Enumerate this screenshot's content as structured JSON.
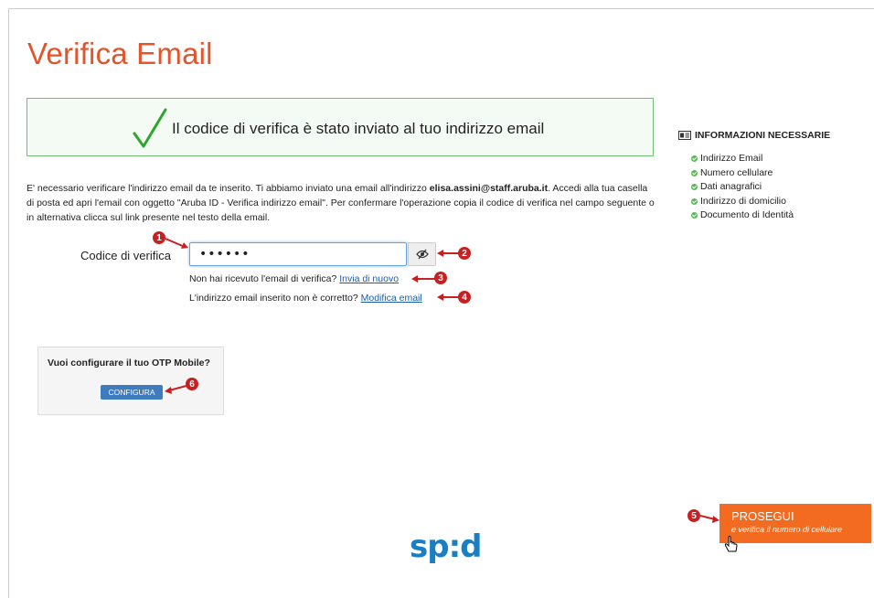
{
  "page": {
    "title": "Verifica Email"
  },
  "success": {
    "message": "Il codice di verifica è stato inviato al tuo indirizzo email"
  },
  "description": {
    "part1": "E' necessario verificare l'indirizzo email da te inserito. Ti abbiamo inviato una email all'indirizzo ",
    "email": "elisa.assini@staff.aruba.it",
    "part2": ". Accedi alla tua casella di posta ed apri l'email con oggetto \"Aruba ID - Verifica indirizzo email\". Per confermare l'operazione copia il codice di verifica nel campo seguente o in alternativa clicca sul link presente nel testo della email."
  },
  "form": {
    "code_label": "Codice di verifica",
    "code_value": "••••••",
    "resend_text": "Non hai ricevuto l'email di verifica? ",
    "resend_link": "Invia di nuovo",
    "wrong_email_text": "L'indirizzo email inserito non è corretto? ",
    "wrong_email_link": "Modifica email"
  },
  "otp": {
    "question": "Vuoi configurare il tuo OTP Mobile?",
    "button": "CONFIGURA"
  },
  "info": {
    "title": "INFORMAZIONI NECESSARIE",
    "items": [
      "Indirizzo Email",
      "Numero cellulare",
      "Dati anagrafici",
      "Indirizzo di domicilio",
      "Documento di Identità"
    ]
  },
  "prosegui": {
    "label": "PROSEGUI",
    "sub": "e verifica il numero di cellulare"
  },
  "logo": {
    "text": "sp:d"
  },
  "annotations": [
    "1",
    "2",
    "3",
    "4",
    "5",
    "6"
  ],
  "colors": {
    "accent": "#e2542b",
    "prosegui": "#f26b21",
    "success_border": "#6fc26f",
    "link": "#1a5fa8",
    "annotation": "#c82020"
  }
}
